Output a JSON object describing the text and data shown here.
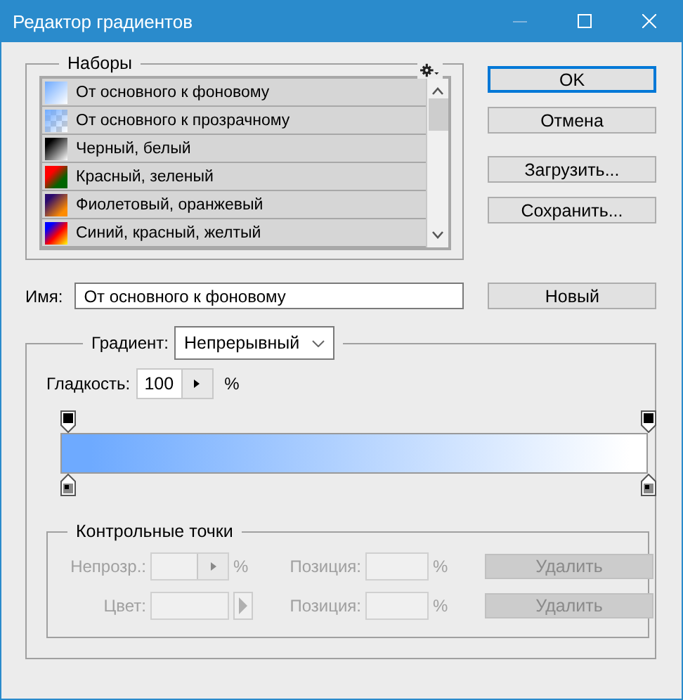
{
  "window": {
    "title": "Редактор градиентов"
  },
  "presets": {
    "title": "Наборы",
    "items": [
      {
        "name": "От основного к фоновому",
        "kind": "foreground"
      },
      {
        "name": "От основного к прозрачному",
        "kind": "transparent"
      },
      {
        "name": "Черный, белый",
        "kind": "blackwhite"
      },
      {
        "name": "Красный, зеленый",
        "kind": "redgreen"
      },
      {
        "name": "Фиолетовый, оранжевый",
        "kind": "violetorange"
      },
      {
        "name": "Синий, красный, желтый",
        "kind": "spectrum"
      }
    ]
  },
  "buttons": [
    {
      "label": "OK",
      "default": true
    },
    {
      "label": "Отмена",
      "default": false
    },
    {
      "label": "Загрузить...",
      "default": false
    },
    {
      "label": "Сохранить...",
      "default": false
    }
  ],
  "name_field": {
    "label": "Имя:",
    "value": "От основного к фоновому"
  },
  "new_button": "Новый",
  "gradient": {
    "type_label": "Градиент:",
    "type_value": "Непрерывный",
    "smoothness_label": "Гладкость:",
    "smoothness_value": "100",
    "smoothness_unit": "%",
    "color": "#6eaaff"
  },
  "stops": {
    "title": "Контрольные точки",
    "disabled": true,
    "rows": [
      {
        "kind": "opacity",
        "label": "Непрозр.:",
        "unit": "%",
        "position_label": "Позиция:",
        "position_unit": "%",
        "delete": "Удалить"
      },
      {
        "kind": "color",
        "label": "Цвет:",
        "position_label": "Позиция:",
        "position_unit": "%",
        "delete": "Удалить"
      }
    ]
  }
}
